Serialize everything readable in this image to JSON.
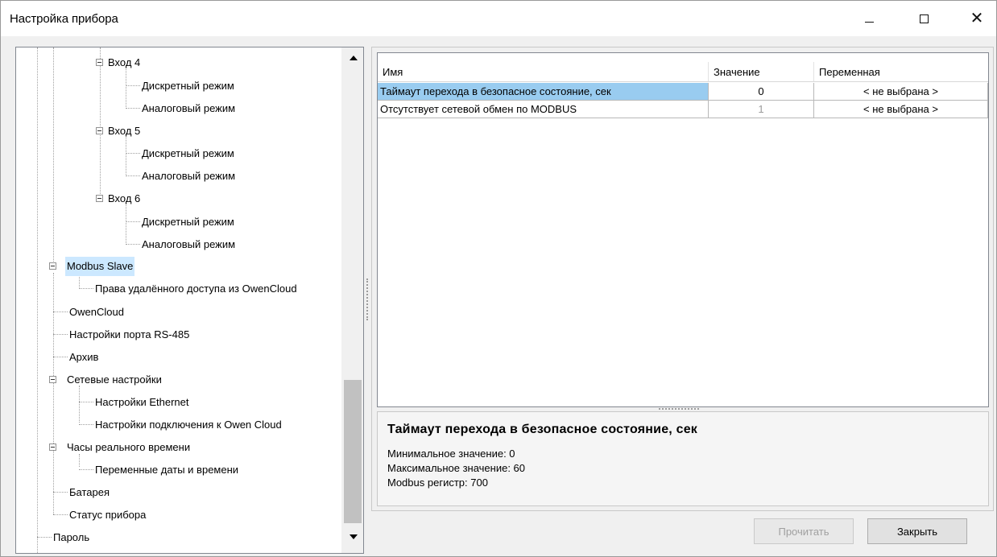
{
  "window": {
    "title": "Настройка прибора"
  },
  "tree": {
    "items": [
      {
        "label": "Вход 4"
      },
      {
        "label": "Дискретный режим"
      },
      {
        "label": "Аналоговый режим"
      },
      {
        "label": "Вход 5"
      },
      {
        "label": "Дискретный режим"
      },
      {
        "label": "Аналоговый режим"
      },
      {
        "label": "Вход 6"
      },
      {
        "label": "Дискретный режим"
      },
      {
        "label": "Аналоговый режим"
      },
      {
        "label": "Modbus Slave"
      },
      {
        "label": "Права удалённого доступа из OwenCloud"
      },
      {
        "label": "OwenCloud"
      },
      {
        "label": "Настройки порта RS-485"
      },
      {
        "label": "Архив"
      },
      {
        "label": "Сетевые настройки"
      },
      {
        "label": "Настройки Ethernet"
      },
      {
        "label": "Настройки подключения к Owen Cloud"
      },
      {
        "label": "Часы реального времени"
      },
      {
        "label": "Переменные даты и времени"
      },
      {
        "label": "Батарея"
      },
      {
        "label": "Статус прибора"
      },
      {
        "label": "Пароль"
      }
    ]
  },
  "grid": {
    "columns": [
      "Имя",
      "Значение",
      "Переменная"
    ],
    "rows": [
      {
        "name": "Таймаут перехода в безопасное состояние, сек",
        "value": "0",
        "variable": "< не выбрана >"
      },
      {
        "name": "Отсутствует сетевой обмен по MODBUS",
        "value": "1",
        "variable": "< не выбрана >"
      }
    ]
  },
  "description": {
    "title": "Таймаут перехода в безопасное состояние, сек",
    "min": "Минимальное значение: 0",
    "max": "Максимальное значение: 60",
    "register": "Modbus регистр: 700"
  },
  "buttons": {
    "read": "Прочитать",
    "close": "Закрыть"
  },
  "colors": {
    "selection": "#cce8ff",
    "grid_selection": "#99ccf0",
    "disabled_text": "#a0a0a0"
  }
}
